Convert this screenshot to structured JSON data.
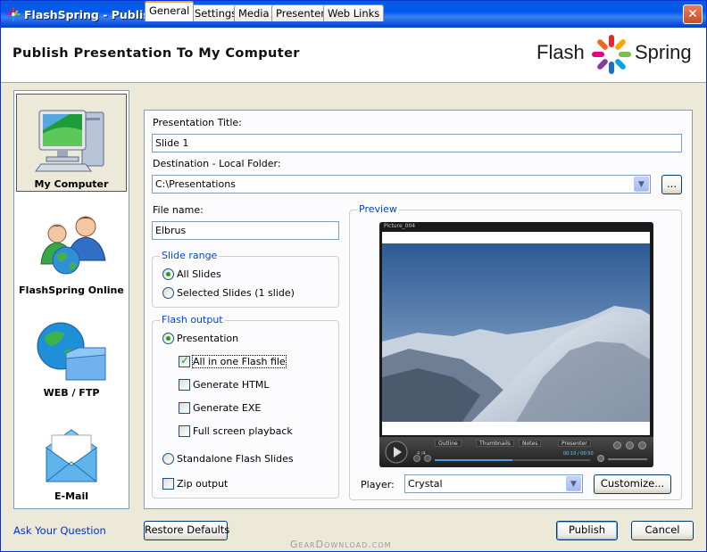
{
  "window": {
    "title": "FlashSpring - Publish To Flash",
    "close_glyph": "✕"
  },
  "header": {
    "heading": "Publish Presentation To My Computer",
    "logo_left": "Flash",
    "logo_right": "Spring"
  },
  "sidebar": {
    "items": [
      {
        "label": "My Computer",
        "icon": "computer-icon",
        "selected": true
      },
      {
        "label": "FlashSpring Online",
        "icon": "users-globe-icon",
        "selected": false
      },
      {
        "label": "WEB / FTP",
        "icon": "globe-folder-icon",
        "selected": false
      },
      {
        "label": "E-Mail",
        "icon": "envelope-icon",
        "selected": false
      }
    ]
  },
  "ask_link": "Ask Your Question",
  "tabs": [
    "General",
    "Settings",
    "Media",
    "Presenter",
    "Web Links"
  ],
  "general": {
    "presentation_title_label": "Presentation Title:",
    "presentation_title_value": "Slide 1",
    "destination_label": "Destination - Local Folder:",
    "destination_value": "C:\\Presentations",
    "browse_label": "...",
    "file_name_label": "File name:",
    "file_name_value": "Elbrus",
    "slide_range": {
      "title": "Slide range",
      "all_slides": "All Slides",
      "selected_slides": "Selected Slides (1 slide)",
      "selected": "all"
    },
    "flash_output": {
      "title": "Flash output",
      "presentation": "Presentation",
      "all_in_one": "All in one Flash file",
      "generate_html": "Generate HTML",
      "generate_exe": "Generate EXE",
      "full_screen": "Full screen playback",
      "standalone": "Standalone Flash Slides",
      "zip_output": "Zip output"
    },
    "preview": {
      "title": "Preview",
      "player_caption": "Picture_004",
      "ctrl_tabs": [
        "Outline",
        "Thumbnails",
        "Notes",
        "Presenter"
      ],
      "time_left": "4 /4",
      "time_right": "00:10 / 00:50"
    },
    "player_label": "Player:",
    "player_value": "Crystal",
    "customize_label": "Customize..."
  },
  "footer": {
    "restore_defaults": "Restore Defaults",
    "publish": "Publish",
    "cancel": "Cancel",
    "watermark": "GearDownload.com"
  }
}
